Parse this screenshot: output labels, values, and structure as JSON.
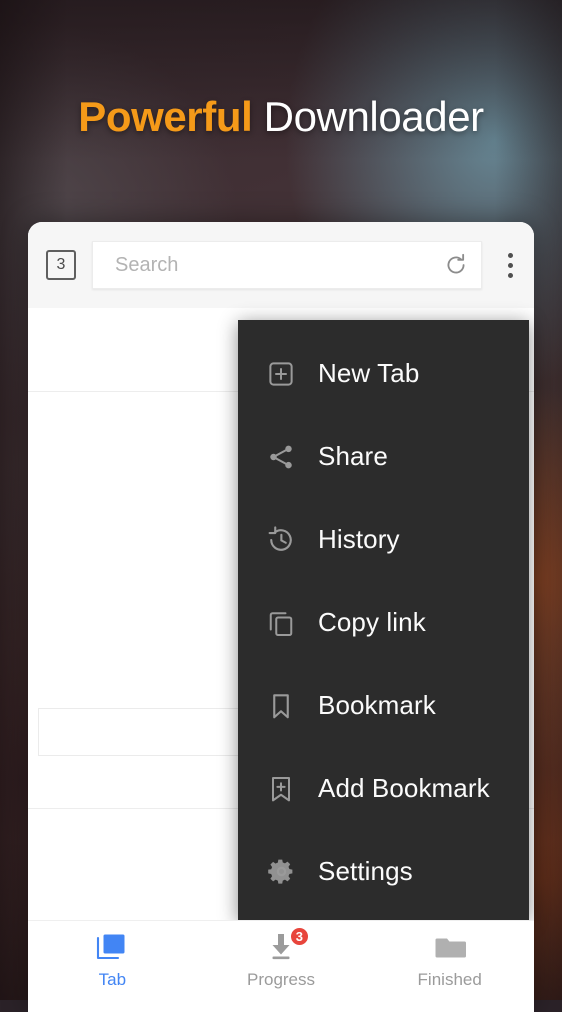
{
  "headline": {
    "strong_word": "Powerful",
    "light_word": "Downloader",
    "strong_color": "#f59a19",
    "light_color": "#ffffff"
  },
  "toolbar": {
    "tab_count": "3",
    "search_value": "",
    "search_placeholder": "Search",
    "refresh_icon": "refresh-icon",
    "overflow_icon": "more-vertical-icon"
  },
  "dropdown_menu": {
    "items": [
      {
        "label": "New Tab",
        "icon": "new-tab-plus-square-icon"
      },
      {
        "label": "Share",
        "icon": "share-nodes-icon"
      },
      {
        "label": "History",
        "icon": "clock-history-icon"
      },
      {
        "label": "Copy link",
        "icon": "copy-icon"
      },
      {
        "label": "Bookmark",
        "icon": "bookmark-outline-icon"
      },
      {
        "label": "Add Bookmark",
        "icon": "bookmark-plus-icon"
      },
      {
        "label": "Settings",
        "icon": "gear-icon"
      }
    ]
  },
  "bottom_nav": {
    "active_color": "#4285f4",
    "badge_color": "#e8453c",
    "items": [
      {
        "label": "Tab",
        "icon": "tabs-stack-icon",
        "badge": "",
        "active": true
      },
      {
        "label": "Progress",
        "icon": "download-arrow-icon",
        "badge": "3",
        "active": false
      },
      {
        "label": "Finished",
        "icon": "folder-icon",
        "badge": "",
        "active": false
      }
    ]
  }
}
